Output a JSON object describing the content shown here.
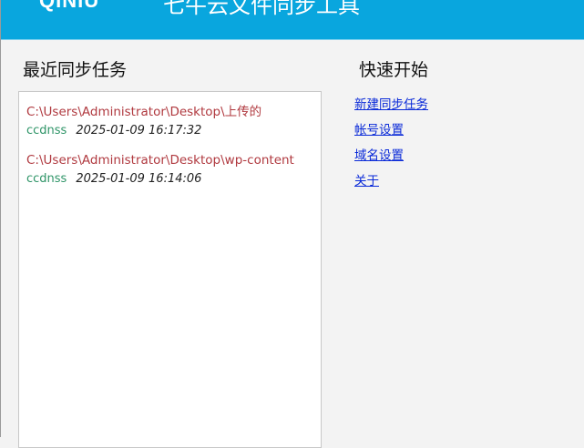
{
  "header": {
    "logo": "QINIU",
    "title": "七牛云文件同步工具",
    "color": "#09a6de"
  },
  "recent": {
    "title": "最近同步任务",
    "items": [
      {
        "path": "C:\\Users\\Administrator\\Desktop\\上传的",
        "user": "ccdnss",
        "time": "2025-01-09 16:17:32"
      },
      {
        "path": "C:\\Users\\Administrator\\Desktop\\wp-content",
        "user": "ccdnss",
        "time": "2025-01-09 16:14:06"
      }
    ]
  },
  "quick": {
    "title": "快速开始",
    "links": [
      "新建同步任务",
      "帐号设置",
      "域名设置",
      "关于"
    ]
  }
}
